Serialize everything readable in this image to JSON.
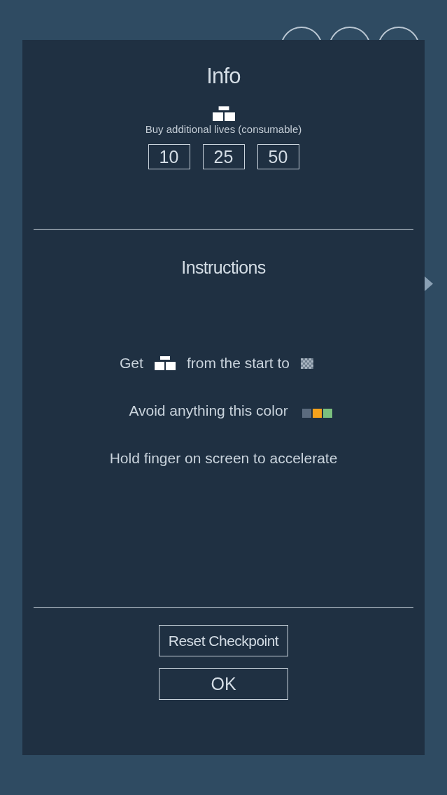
{
  "info": {
    "title": "Info",
    "subtitle": "Buy additional lives (consumable)",
    "options": [
      "10",
      "25",
      "50"
    ]
  },
  "instructions": {
    "title": "Instructions",
    "lines": [
      {
        "kind": "goal",
        "parts": [
          "Get",
          "from the start to"
        ]
      },
      {
        "kind": "avoid",
        "text": "Avoid anything this color",
        "swatches": [
          {
            "color": "#5b6b7e"
          },
          {
            "color": "#f5a21c"
          },
          {
            "color": "#7bbf7e"
          }
        ]
      },
      {
        "kind": "plain",
        "text": "Hold finger on screen to accelerate"
      }
    ]
  },
  "buttons": [
    "Reset Checkpoint",
    "OK"
  ]
}
